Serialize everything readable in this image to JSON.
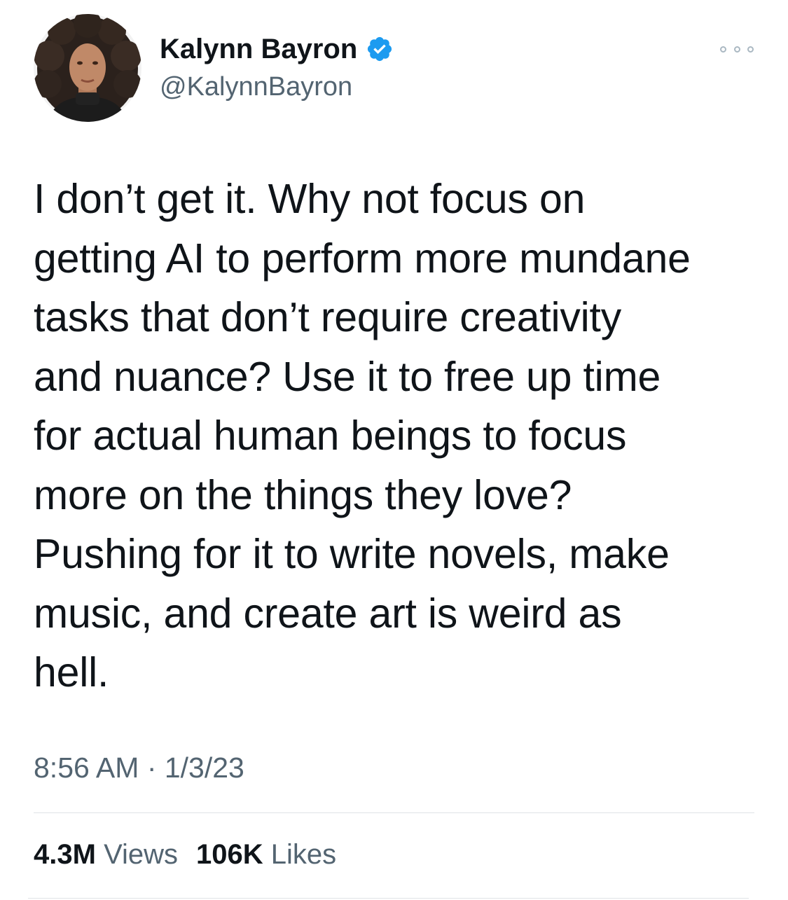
{
  "author": {
    "display_name": "Kalynn Bayron",
    "handle": "@KalynnBayron",
    "verified": true,
    "verified_color": "#1d9bf0"
  },
  "tweet": {
    "text": "I don’t get it. Why not focus on\ngetting AI to perform more mundane\ntasks that don’t require creativity\nand nuance? Use it to free up time\nfor actual human beings to focus\nmore on the things they love?\nPushing for it to write novels, make\nmusic, and create art is weird as\nhell.",
    "timestamp": "8:56 AM · 1/3/23"
  },
  "stats": {
    "views_count": "4.3M",
    "views_label": "Views",
    "likes_count": "106K",
    "likes_label": "Likes"
  },
  "icons": {
    "verified": "verified-badge-icon",
    "more": "more-options-icon"
  }
}
